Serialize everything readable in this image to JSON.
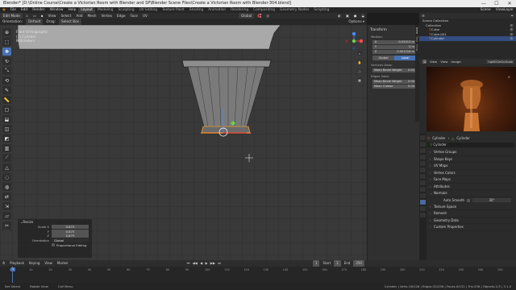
{
  "window": {
    "title": "Blender* [D:\\Online Course\\Create a Victorian Room with Blender and SP\\Blender Scene Files\\Create a Victorian Room with Blender-304.blend]",
    "min": "—",
    "max": "☐",
    "close": "✕"
  },
  "menubar": {
    "items": [
      "File",
      "Edit",
      "Render",
      "Window",
      "Help"
    ],
    "workspaces": [
      "Layout",
      "Modeling",
      "Sculpting",
      "UV Editing",
      "Texture Paint",
      "Shading",
      "Animation",
      "Rendering",
      "Compositing",
      "Geometry Nodes",
      "Scripting"
    ],
    "active_workspace": "Layout",
    "scene": "Scene",
    "view_layer": "ViewLayer"
  },
  "viewport_header": {
    "mode": "Edit Mode",
    "menus": [
      "View",
      "Select",
      "Add",
      "Mesh",
      "Vertex",
      "Edge",
      "Face",
      "UV"
    ],
    "transform_orientation": "Global",
    "proportional": "Proportional"
  },
  "tool_header": {
    "orientation_label": "Orientation:",
    "orientation_value": "Default",
    "drag_label": "Drag:",
    "drag_value": "Select Box"
  },
  "viewport_info": {
    "line1": "Front Orthographic",
    "line2": "(1) Cylinder",
    "line3": "Millimeters"
  },
  "toolbar": {
    "tools": [
      "cursor",
      "select",
      "move",
      "rotate",
      "scale",
      "transform",
      "annotate",
      "measure",
      "add-cube",
      "extrude",
      "inset",
      "bevel",
      "loop-cut",
      "knife",
      "poly-build",
      "spin",
      "smooth",
      "edge-slide",
      "shrink",
      "shear",
      "rip"
    ]
  },
  "npanel": {
    "section": "Transform",
    "median_label": "Median:",
    "fields": [
      {
        "axis": "X",
        "value": "-0.02013 m"
      },
      {
        "axis": "Y",
        "value": "0 m"
      },
      {
        "axis": "Z",
        "value": "0.001218 m"
      }
    ],
    "toggle": [
      "Global",
      "Local"
    ],
    "toggle_active": "Local",
    "vertices_label": "Vertices Data:",
    "vertices_field": {
      "label": "Mean Bevel Weight",
      "value": "0.00"
    },
    "edges_label": "Edges Data:",
    "edges_fields": [
      {
        "label": "Mean Bevel Weight",
        "value": "0.00"
      },
      {
        "label": "Mean Crease",
        "value": "0.00"
      }
    ],
    "tabs": [
      "Item",
      "Tool",
      "View"
    ]
  },
  "outliner": {
    "header": "Scene Collection",
    "rows": [
      {
        "label": "Scene Collection",
        "indent": 0,
        "selected": false
      },
      {
        "label": "Collection",
        "indent": 1,
        "selected": false
      },
      {
        "label": "Cube",
        "indent": 2,
        "selected": false
      },
      {
        "label": "Cube.001",
        "indent": 2,
        "selected": false
      },
      {
        "label": "Cylinder",
        "indent": 2,
        "selected": true
      }
    ]
  },
  "image_editor": {
    "menus": [
      "View",
      "View",
      "Image"
    ],
    "image_name": "hq6t52eSvXcab"
  },
  "properties": {
    "object_path": "Cylinder",
    "mesh_name": "Cylinder",
    "sections": [
      "Vertex Groups",
      "Shape Keys",
      "UV Maps",
      "Vertex Colors",
      "Face Maps",
      "Attributes",
      "Normals",
      "Texture Space",
      "Remesh",
      "Geometry Data",
      "Custom Properties"
    ],
    "auto_smooth_label": "Auto Smooth",
    "auto_smooth_value": "30°"
  },
  "operator_panel": {
    "title": "Resize",
    "rows": [
      {
        "label": "Scale X",
        "value": "0.873"
      },
      {
        "label": "Y",
        "value": "0.873"
      },
      {
        "label": "Z",
        "value": "0.873"
      }
    ],
    "orientation_label": "Orientation",
    "orientation_value": "Global",
    "proportional_label": "Proportional Editing"
  },
  "timeline": {
    "menus": [
      "Playback",
      "Keying",
      "View",
      "Marker"
    ],
    "current_frame": "1",
    "start_label": "Start",
    "start": "1",
    "end_label": "End",
    "end": "250",
    "ticks": [
      "0",
      "10",
      "20",
      "30",
      "40",
      "50",
      "60",
      "70",
      "80",
      "90",
      "100",
      "110",
      "120",
      "130",
      "140",
      "150",
      "160",
      "170",
      "180",
      "190",
      "200",
      "210",
      "220",
      "230",
      "240",
      "250"
    ]
  },
  "statusbar": {
    "left": [
      "Set Select",
      "Rotate View",
      "Call Menu"
    ],
    "right": "Cylinder | Verts:16/128 | Edges:32/256 | Faces:0/132 | Tris:256 | Objects:1/3 | 3.1.0"
  }
}
